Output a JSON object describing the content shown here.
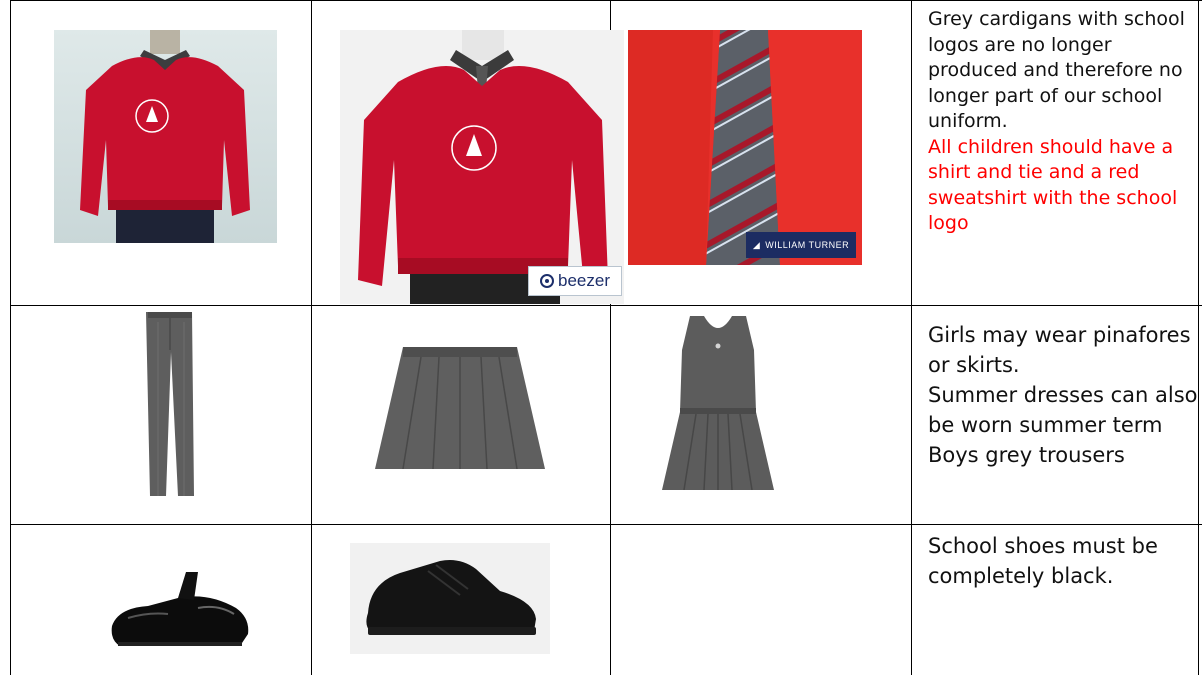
{
  "rows": [
    {
      "images": [
        "red-sweatshirt-crew-icon",
        "red-sweatshirt-beezer-icon",
        "striped-tie-icon"
      ],
      "brand_labels": {
        "beezer": "beezer",
        "william_turner": "WILLIAM TURNER"
      },
      "text_black": "Grey cardigans with school logos are no longer produced and therefore no longer part of our school uniform.",
      "text_red": "All children should have a shirt and tie and a red sweatshirt with the school logo"
    },
    {
      "images": [
        "grey-trousers-icon",
        "grey-skirt-icon",
        "grey-pinafore-icon"
      ],
      "text_lines": [
        "Girls may wear pinafores or skirts.",
        "Summer dresses can also be worn summer term",
        "Boys grey trousers"
      ]
    },
    {
      "images": [
        "black-patent-shoe-icon",
        "black-trainer-shoe-icon"
      ],
      "text": "School shoes must be completely black."
    }
  ],
  "colors": {
    "sweatshirt_red": "#c8102e",
    "tie_red_background": "#e8302b",
    "grey_fabric": "#5e5e5e",
    "note_red": "#ff0000"
  }
}
